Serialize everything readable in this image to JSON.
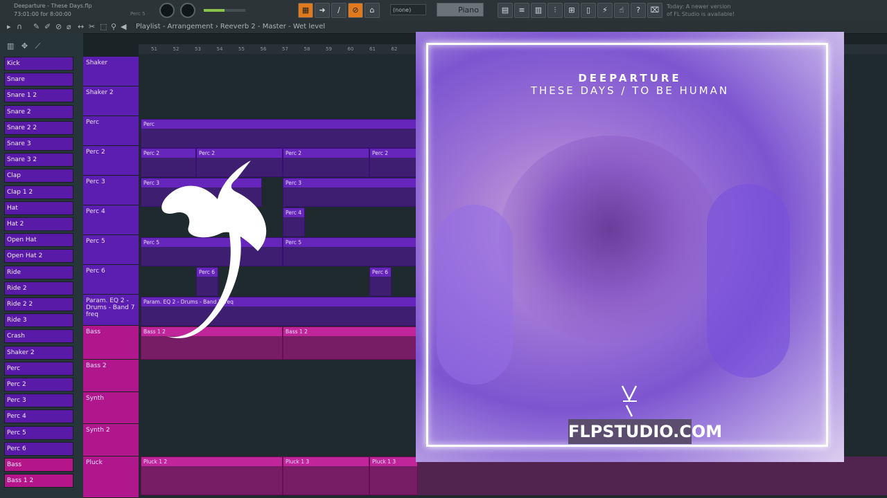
{
  "topbar": {
    "project_title": "Deeparture - These Days.flp",
    "time": "73:01:00 for 8:00:00",
    "channel_label": "Perc 5",
    "snap_value": "(none)",
    "instrument": "Piano",
    "news_line1": "Today: A newer version",
    "news_line2": "of FL Studio is available!"
  },
  "bar2": {
    "breadcrumb": "Playlist - Arrangement › Reeverb 2 - Master - Wet level"
  },
  "ruler": {
    "ticks": [
      "51",
      "52",
      "53",
      "54",
      "55",
      "56",
      "57",
      "58",
      "59",
      "60",
      "61",
      "62"
    ]
  },
  "channels": [
    "Kick",
    "Snare",
    "Snare 1 2",
    "Snare 2",
    "Snare 2 2",
    "Snare 3",
    "Snare 3 2",
    "Clap",
    "Clap 1 2",
    "Hat",
    "Hat 2",
    "Open Hat",
    "Open Hat 2",
    "Ride",
    "Ride 2",
    "Ride 2 2",
    "Ride 3",
    "Crash",
    "Shaker 2",
    "Perc",
    "Perc 2",
    "Perc 3",
    "Perc 4",
    "Perc 5",
    "Perc 6",
    "Bass",
    "Bass 1 2"
  ],
  "tracks": [
    "Shaker",
    "Shaker 2",
    "Perc",
    "Perc 2",
    "Perc 3",
    "Perc 4",
    "Perc 5",
    "Perc 6",
    "Param. EQ 2 - Drums - Band 7 freq",
    "Bass",
    "Bass 2",
    "Synth",
    "Synth 2",
    "Pluck"
  ],
  "clips": {
    "perc": "Perc",
    "perc2": "Perc 2",
    "perc3": "Perc 3",
    "perc4": "Perc 4",
    "perc5": "Perc 5",
    "perc6": "Perc 6",
    "eq": "Param. EQ 2 - Drums - Band 7 freq",
    "bass": "Bass 1 2",
    "pluck12": "Pluck 1 2",
    "pluck13": "Pluck 1 3"
  },
  "overlay": {
    "artist": "DEEPARTURE",
    "album": "THESE DAYS / TO BE HUMAN",
    "site_badge": "FLPSTUDIO.COM"
  }
}
